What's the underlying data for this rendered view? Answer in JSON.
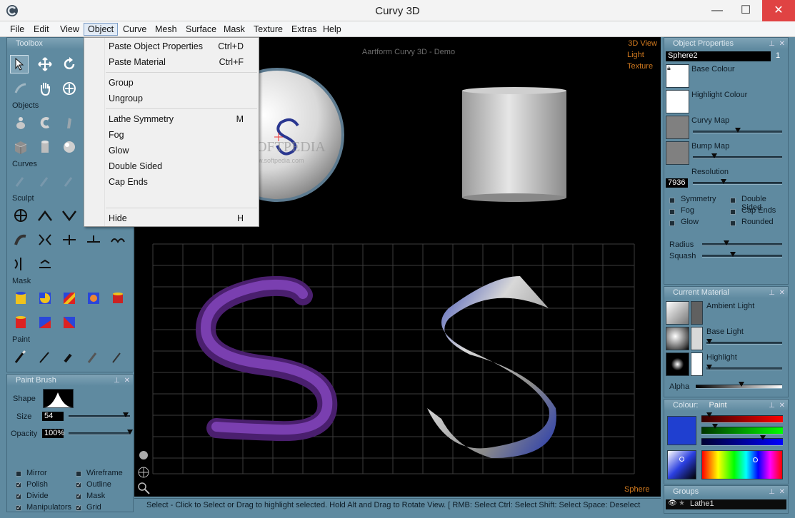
{
  "window": {
    "title": "Curvy 3D",
    "min": "—",
    "max": "☐",
    "close": "✕"
  },
  "menus": [
    "File",
    "Edit",
    "View",
    "Object",
    "Curve",
    "Mesh",
    "Surface",
    "Mask",
    "Texture",
    "Extras",
    "Help"
  ],
  "object_menu": [
    {
      "label": "Paste Object Properties",
      "shortcut": "Ctrl+D"
    },
    {
      "label": "Paste Material",
      "shortcut": "Ctrl+F"
    },
    {
      "label": "Group",
      "shortcut": ""
    },
    {
      "label": "Ungroup",
      "shortcut": ""
    },
    {
      "label": "Lathe Symmetry",
      "shortcut": "M"
    },
    {
      "label": "Fog",
      "shortcut": ""
    },
    {
      "label": "Glow",
      "shortcut": ""
    },
    {
      "label": "Double Sided",
      "shortcut": ""
    },
    {
      "label": "Cap Ends",
      "shortcut": ""
    },
    {
      "label": "Hide",
      "shortcut": "H"
    }
  ],
  "toolbox": {
    "title": "Toolbox",
    "sections": {
      "objects": "Objects",
      "curves": "Curves",
      "sculpt": "Sculpt",
      "mask": "Mask",
      "paint": "Paint"
    }
  },
  "paint_brush": {
    "title": "Paint Brush",
    "shape_label": "Shape",
    "size_label": "Size",
    "size": "54",
    "size_level": 0.93,
    "opacity_label": "Opacity",
    "opacity": "100%",
    "opacity_level": 1.0,
    "options": [
      {
        "label": "Mirror",
        "checked": false
      },
      {
        "label": "Wireframe",
        "checked": false
      },
      {
        "label": "Polish",
        "checked": true
      },
      {
        "label": "Outline",
        "checked": true
      },
      {
        "label": "Divide",
        "checked": true
      },
      {
        "label": "Mask",
        "checked": true
      },
      {
        "label": "Manipulators",
        "checked": true
      },
      {
        "label": "Grid",
        "checked": true
      }
    ]
  },
  "viewport": {
    "caption": "Aartform Curvy 3D - Demo",
    "modes": [
      "3D View",
      "Light",
      "Texture"
    ],
    "selected_name": "Sphere",
    "watermark": "SOFTPEDIA",
    "watermark_sub": "www.softpedia.com"
  },
  "status": "Select - Click to Select or Drag to highlight selected. Hold Alt and Drag to Rotate View.  [ RMB: Select   Ctrl: Select   Shift: Select   Space: Deselect",
  "object_properties": {
    "title": "Object Properties",
    "name": "Sphere2",
    "index": "1",
    "base_colour": "Base Colour",
    "highlight_colour": "Highlight Colour",
    "curvy_map": "Curvy Map",
    "curvy_map_level": 0.5,
    "bump_map": "Bump Map",
    "bump_map_level": 0.24,
    "resolution_label": "Resolution",
    "resolution": "7936",
    "resolution_level": 0.34,
    "options": [
      {
        "label": "Symmetry"
      },
      {
        "label": "Double Sided"
      },
      {
        "label": "Fog"
      },
      {
        "label": "Cap Ends"
      },
      {
        "label": "Glow"
      },
      {
        "label": "Rounded"
      }
    ],
    "radius_label": "Radius",
    "radius_level": 0.3,
    "squash_label": "Squash",
    "squash_level": 0.38
  },
  "current_material": {
    "title": "Current Material",
    "ambient": "Ambient Light",
    "base": "Base Light",
    "highlight": "Highlight",
    "alpha_label": "Alpha",
    "alpha_level": 0.53
  },
  "colour": {
    "title": "Colour:",
    "mode": "Paint",
    "red_level": 0.1,
    "green_level": 0.17,
    "blue_level": 0.75,
    "swatch": "#1f3fd0"
  },
  "groups": {
    "title": "Groups",
    "item": "Lathe1"
  }
}
